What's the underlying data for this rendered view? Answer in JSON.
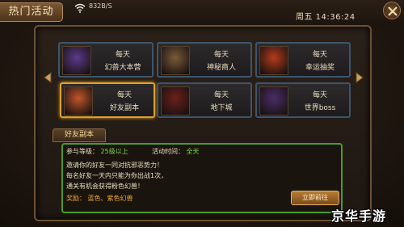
{
  "header": {
    "title": "热门活动",
    "speed": "832B/S",
    "clock": "周五 14:36:24",
    "wifi_icon": "wifi-icon",
    "close_icon": "close-icon"
  },
  "activities": [
    {
      "line1": "每天",
      "line2": "幻兽大本营",
      "portrait": "dragon-monster",
      "color": "#5b3a8c",
      "selected": false
    },
    {
      "line1": "每天",
      "line2": "神秘商人",
      "portrait": "witch-merchant",
      "color": "#7a5a3a",
      "selected": false
    },
    {
      "line1": "每天",
      "line2": "幸运抽奖",
      "portrait": "gift-box",
      "color": "#b53a1c",
      "selected": false
    },
    {
      "line1": "每天",
      "line2": "好友副本",
      "portrait": "friend-heroes",
      "color": "#c2552a",
      "selected": true
    },
    {
      "line1": "每天",
      "line2": "地下城",
      "portrait": "dungeon-demon",
      "color": "#6b1f1a",
      "selected": false
    },
    {
      "line1": "每天",
      "line2": "世界boss",
      "portrait": "world-boss-dragon",
      "color": "#4a2d6a",
      "selected": false
    }
  ],
  "detail": {
    "tab_label": "好友副本",
    "level_label": "参与等级：",
    "level_value": "25级以上",
    "time_label": "活动时间：",
    "time_value": "全天",
    "desc1": "邀请你的好友一同对抗邪恶势力！",
    "desc2": "每名好友一天内只能为你出战1次，",
    "desc3": "通关有机会获得粉色幻兽！",
    "reward_label": "奖励：",
    "reward_value": "蓝色、紫色幻兽",
    "go_button": "立即前往"
  },
  "watermark": "京华手游",
  "colors": {
    "accent_gold": "#e0a128",
    "info_border_green": "#4e9a2c",
    "value_green": "#7fd64a",
    "value_orange": "#f0a838"
  }
}
